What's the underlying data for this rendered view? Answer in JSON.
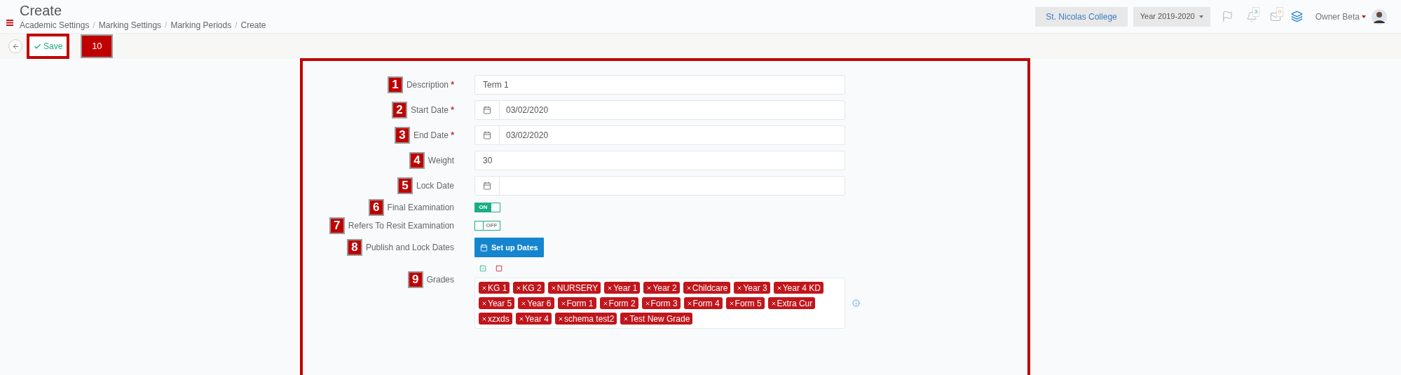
{
  "header": {
    "title": "Create",
    "breadcrumbs": [
      {
        "label": "Academic Settings",
        "separator": "/"
      },
      {
        "label": "Marking Settings",
        "separator": "/"
      },
      {
        "label": "Marking Periods",
        "separator": "/"
      },
      {
        "label": "Create"
      }
    ]
  },
  "top_bar": {
    "school": "St. Nicolas College",
    "year": "Year 2019-2020",
    "notifications": "3",
    "messages": "0",
    "user": "Owner Beta"
  },
  "toolbar": {
    "save": "Save",
    "annotation": "10"
  },
  "form": {
    "fields": [
      {
        "kind": "text",
        "annotation": "1",
        "label": "Description",
        "required_mark": "*",
        "value": "Term 1"
      },
      {
        "kind": "date",
        "annotation": "2",
        "label": "Start Date",
        "required_mark": "*",
        "value": "03/02/2020"
      },
      {
        "kind": "date",
        "annotation": "3",
        "label": "End Date",
        "required_mark": "*",
        "value": "03/02/2020"
      },
      {
        "kind": "text",
        "annotation": "4",
        "label": "Weight",
        "value": "30"
      },
      {
        "kind": "date",
        "annotation": "5",
        "label": "Lock Date"
      },
      {
        "kind": "toggle",
        "annotation": "6",
        "label": "Final Examination",
        "on": true,
        "text": "ON"
      },
      {
        "kind": "toggle",
        "annotation": "7",
        "label": "Refers To Resit Examination",
        "on": false,
        "text": "OFF"
      },
      {
        "kind": "button",
        "annotation": "8",
        "label": "Publish and Lock Dates",
        "button": "Set up Dates"
      },
      {
        "kind": "tags",
        "annotation": "9",
        "label": "Grades",
        "tags": [
          "KG 1",
          "KG 2",
          "NURSERY",
          "Year 1",
          "Year 2",
          "Childcare",
          "Year 3",
          "Year 4 KD",
          "Year 5",
          "Year 6",
          "Form 1",
          "Form 2",
          "Form 3",
          "Form 4",
          "Form 5",
          "Extra Cur",
          "xzxds",
          "Year 4",
          "schema test2",
          "Test New Grade"
        ]
      }
    ]
  }
}
